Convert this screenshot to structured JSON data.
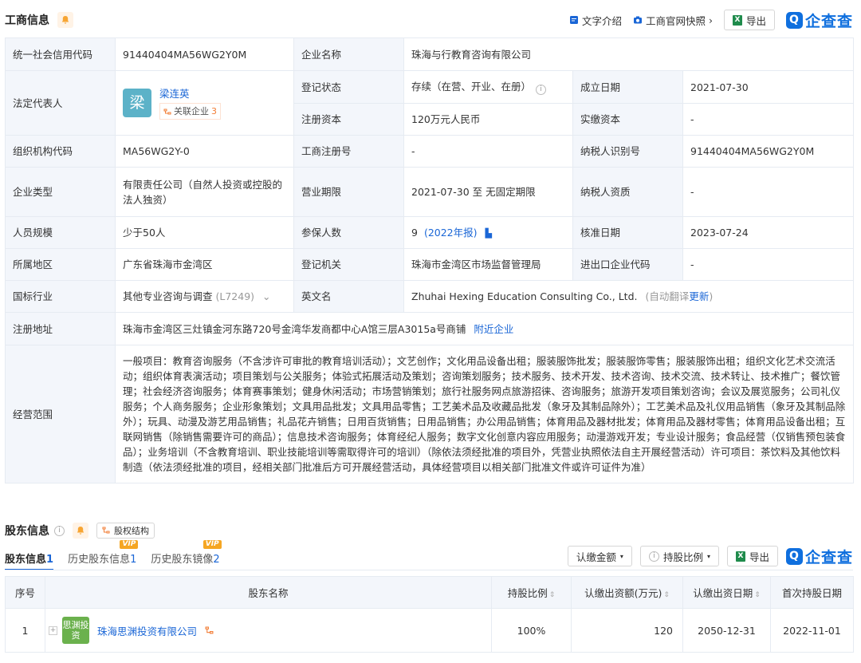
{
  "business": {
    "title": "工商信息",
    "actions": {
      "text_intro": "文字介绍",
      "snapshot": "工商官网快照",
      "export": "导出"
    },
    "logo": "企查查",
    "rows": {
      "credit_code_label": "统一社会信用代码",
      "credit_code": "91440404MA56WG2Y0M",
      "name_label": "企业名称",
      "name": "珠海与行教育咨询有限公司",
      "legal_rep_label": "法定代表人",
      "legal_rep_avatar": "梁",
      "legal_rep": "梁连英",
      "related_label": "关联企业",
      "related_count": "3",
      "reg_status_label": "登记状态",
      "reg_status": "存续（在营、开业、在册）",
      "founded_label": "成立日期",
      "founded": "2021-07-30",
      "reg_capital_label": "注册资本",
      "reg_capital": "120万元人民币",
      "paid_capital_label": "实缴资本",
      "paid_capital": "-",
      "org_code_label": "组织机构代码",
      "org_code": "MA56WG2Y-0",
      "biz_reg_no_label": "工商注册号",
      "biz_reg_no": "-",
      "taxpayer_id_label": "纳税人识别号",
      "taxpayer_id": "91440404MA56WG2Y0M",
      "company_type_label": "企业类型",
      "company_type": "有限责任公司（自然人投资或控股的法人独资）",
      "term_label": "营业期限",
      "term": "2021-07-30 至 无固定期限",
      "taxpayer_qual_label": "纳税人资质",
      "taxpayer_qual": "-",
      "staff_label": "人员规模",
      "staff": "少于50人",
      "insured_label": "参保人数",
      "insured": "9",
      "insured_report": "(2022年报)",
      "approval_date_label": "核准日期",
      "approval_date": "2023-07-24",
      "region_label": "所属地区",
      "region": "广东省珠海市金湾区",
      "authority_label": "登记机关",
      "authority": "珠海市金湾区市场监督管理局",
      "ie_code_label": "进出口企业代码",
      "ie_code": "-",
      "industry_label": "国标行业",
      "industry": "其他专业咨询与调查",
      "industry_code": "(L7249)",
      "english_label": "英文名",
      "english": "Zhuhai Hexing Education Consulting Co., Ltd.",
      "auto_translate": "(自动翻译",
      "update": "更新",
      "close_paren": ")",
      "address_label": "注册地址",
      "address": "珠海市金湾区三灶镇金河东路720号金湾华发商都中心A馆三层A3015a号商铺",
      "nearby": "附近企业",
      "scope_label": "经营范围",
      "scope": "一般项目：教育咨询服务（不含涉许可审批的教育培训活动）；文艺创作；文化用品设备出租；服装服饰批发；服装服饰零售；服装服饰出租；组织文化艺术交流活动；组织体育表演活动；项目策划与公关服务；体验式拓展活动及策划；咨询策划服务；技术服务、技术开发、技术咨询、技术交流、技术转让、技术推广；餐饮管理；社会经济咨询服务；体育赛事策划；健身休闲活动；市场营销策划；旅行社服务网点旅游招徕、咨询服务；旅游开发项目策划咨询；会议及展览服务；公司礼仪服务；个人商务服务；企业形象策划；文具用品批发；文具用品零售；工艺美术品及收藏品批发（象牙及其制品除外）；工艺美术品及礼仪用品销售（象牙及其制品除外）；玩具、动漫及游艺用品销售；礼品花卉销售；日用百货销售；日用品销售；办公用品销售；体育用品及器材批发；体育用品及器材零售；体育用品设备出租；互联网销售（除销售需要许可的商品）；信息技术咨询服务；体育经纪人服务；数字文化创意内容应用服务；动漫游戏开发；专业设计服务；食品经营（仅销售预包装食品）；业务培训（不含教育培训、职业技能培训等需取得许可的培训）（除依法须经批准的项目外，凭营业执照依法自主开展经营活动）许可项目：茶饮料及其他饮料制造（依法须经批准的项目，经相关部门批准后方可开展经营活动，具体经营项目以相关部门批准文件或许可证件为准）"
    }
  },
  "shareholders": {
    "title": "股东信息",
    "equity_structure": "股权结构",
    "tabs": [
      {
        "label": "股东信息",
        "count": "1"
      },
      {
        "label": "历史股东信息",
        "count": "1",
        "badge": "VIP"
      },
      {
        "label": "历史股东镜像",
        "count": "2",
        "badge": "VIP"
      }
    ],
    "filters": {
      "subscribed": "认缴金额",
      "ratio": "持股比例",
      "export": "导出"
    },
    "logo": "企查查",
    "columns": [
      "序号",
      "股东名称",
      "持股比例",
      "认缴出资额(万元)",
      "认缴出资日期",
      "首次持股日期"
    ],
    "rows": [
      {
        "index": "1",
        "logo_text": "思渊投资",
        "name": "珠海思渊投资有限公司",
        "ratio": "100%",
        "amount": "120",
        "date": "2050-12-31",
        "first_date": "2022-11-01"
      }
    ]
  }
}
